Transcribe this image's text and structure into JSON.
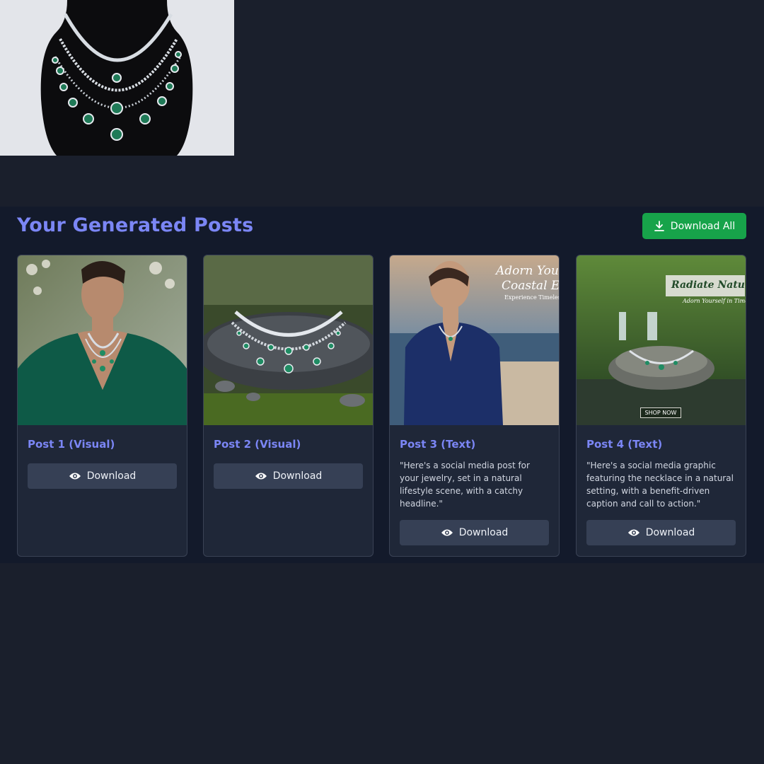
{
  "section": {
    "title": "Your Generated Posts",
    "download_all_label": "Download All",
    "download_all_icon": "download-icon",
    "accent_color": "#7b86f5",
    "download_all_color": "#17a34a"
  },
  "posts": [
    {
      "title": "Post 1 (Visual)",
      "description": "",
      "download_label": "Download",
      "download_icon": "eye-icon"
    },
    {
      "title": "Post 2 (Visual)",
      "description": "",
      "download_label": "Download",
      "download_icon": "eye-icon"
    },
    {
      "title": "Post 3 (Text)",
      "description": "\"Here's a social media post for your jewelry, set in a natural lifestyle scene, with a catchy headline.\"",
      "download_label": "Download",
      "download_icon": "eye-icon",
      "overlay": {
        "headline_1": "Adorn Yourself",
        "headline_2": "Coastal Elegance",
        "tagline": "Experience Timeless E"
      }
    },
    {
      "title": "Post 4 (Text)",
      "description": "\"Here's a social media graphic featuring the necklace in a natural setting, with a benefit-driven caption and call to action.\"",
      "download_label": "Download",
      "download_icon": "eye-icon",
      "overlay": {
        "headline": "Radiate Natural",
        "tagline": "Adorn Yourself in Timeless",
        "cta": "SHOP NOW"
      }
    }
  ]
}
